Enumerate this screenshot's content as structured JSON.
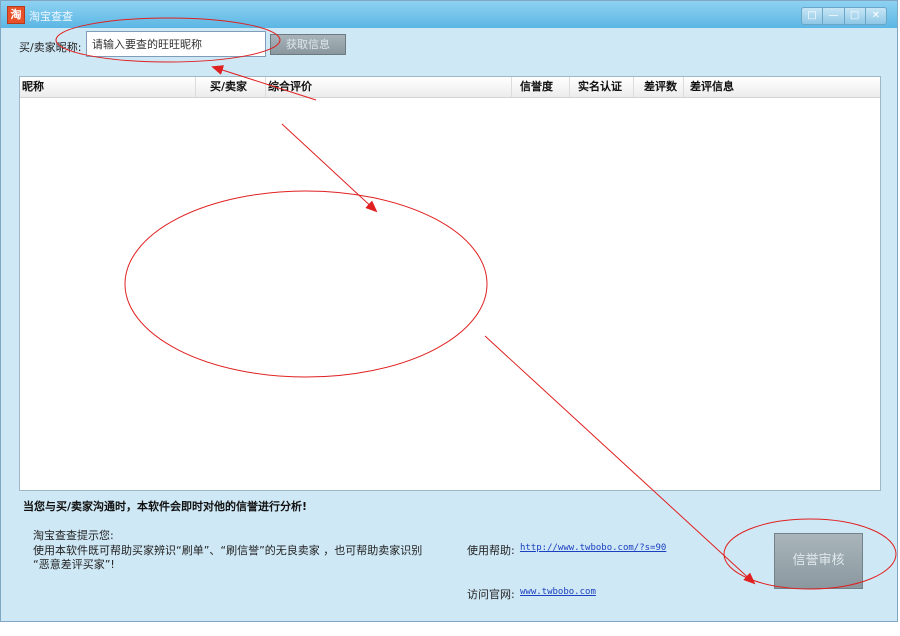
{
  "window": {
    "title": "淘宝查查",
    "app_icon_glyph": "淘",
    "controls": [
      "□",
      "—",
      "□",
      "✕"
    ]
  },
  "search": {
    "label": "买/卖家昵称:",
    "value": "请输入要查的旺旺昵称",
    "fetch_button": "获取信息"
  },
  "table": {
    "columns": [
      "昵称",
      "买/卖家",
      "综合评价",
      "信誉度",
      "实名认证",
      "差评数",
      "差评信息"
    ],
    "rows": []
  },
  "notice": "当您与买/卖家沟通时，本软件会即时对他的信誉进行分析!",
  "tips": {
    "title": "淘宝查查提示您:",
    "lines": [
      "使用本软件既可帮助买家辨识“刷单”、“刷信誉”的无良卖家 ，也可帮助卖家识别",
      "“恶意差评买家”!"
    ]
  },
  "help": {
    "label": "使用帮助:",
    "link": "http://www.twbobo.com/?s=90"
  },
  "site": {
    "label": "访问官网:",
    "link": "www.twbobo.com"
  },
  "audit_button": "信誉审核",
  "colors": {
    "title_bar": "#5bb6e4",
    "window_bg": "#cfe8f5",
    "annotation": "#e02020",
    "link": "#1a3fbf"
  }
}
